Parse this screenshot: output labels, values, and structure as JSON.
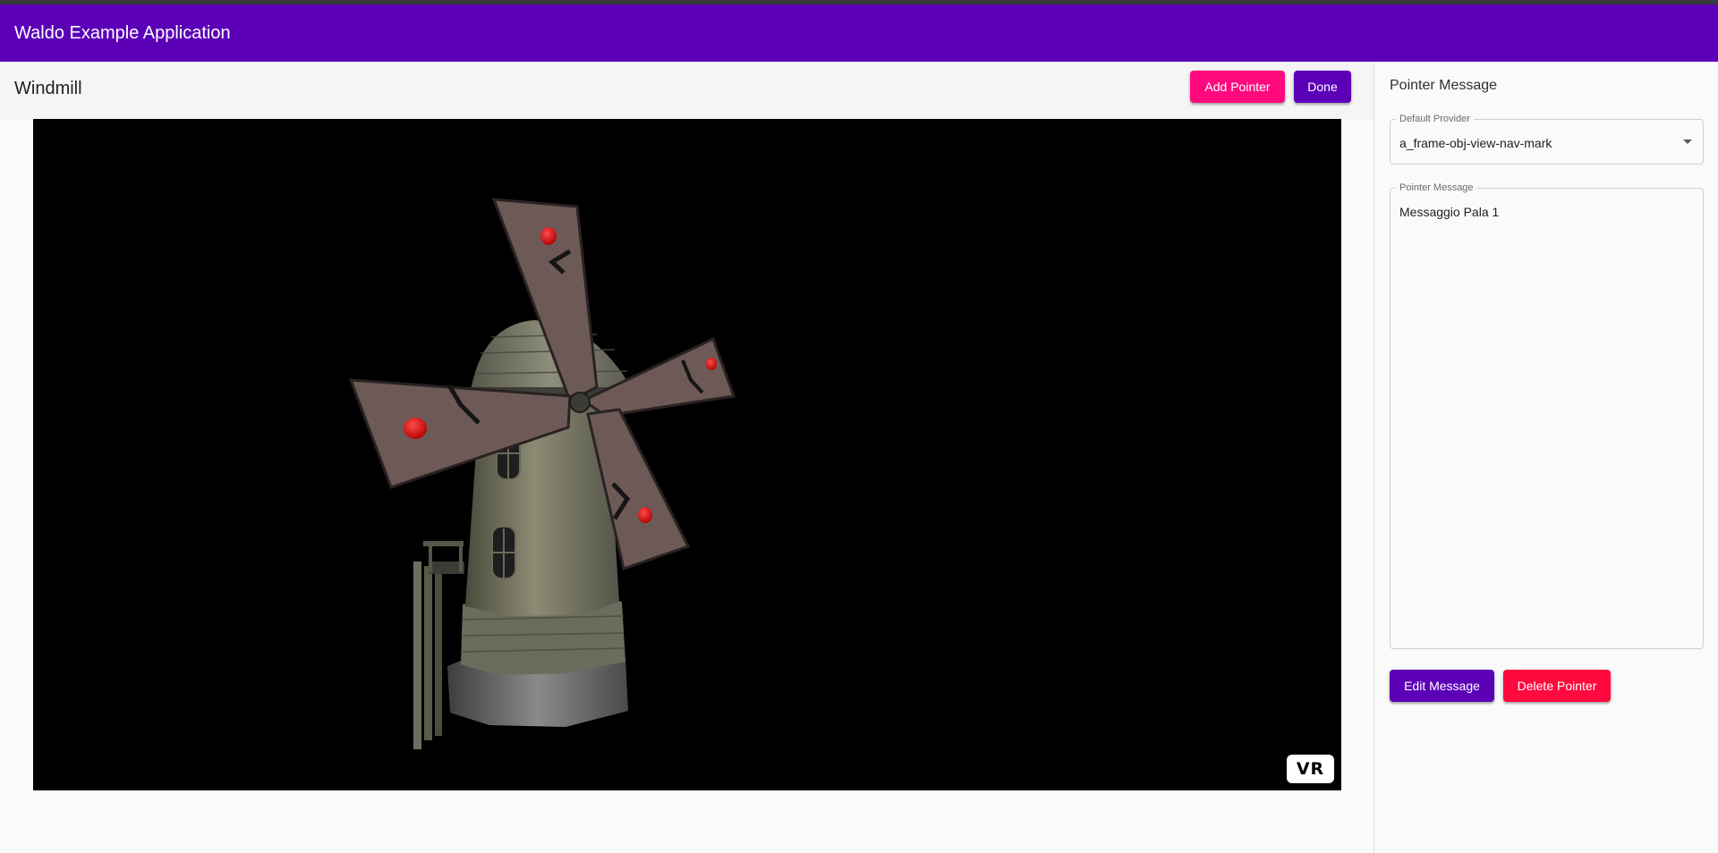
{
  "app": {
    "title": "Waldo Example Application"
  },
  "editor": {
    "title": "Windmill",
    "add_pointer_label": "Add Pointer",
    "done_label": "Done",
    "vr_label": "VR"
  },
  "side_panel": {
    "title": "Pointer Message",
    "provider": {
      "label": "Default Provider",
      "value": "a_frame-obj-view-nav-mark"
    },
    "message": {
      "label": "Pointer Message",
      "value": "Messaggio Pala 1"
    },
    "edit_label": "Edit Message",
    "delete_label": "Delete Pointer"
  },
  "colors": {
    "primary": "#5c00b8",
    "accent_pink": "#ff0a7e",
    "danger": "#ff0a3e",
    "pointer": "#e00000"
  }
}
